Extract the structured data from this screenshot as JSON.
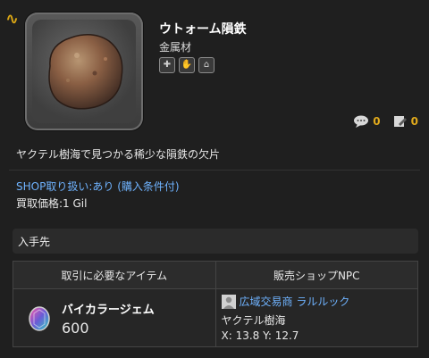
{
  "item": {
    "name": "ウトォーム隕鉄",
    "category": "金属材",
    "description": "ヤクテル樹海で見つかる稀少な隕鉄の欠片",
    "badges": [
      {
        "icon": "plus-icon",
        "glyph": "✚"
      },
      {
        "icon": "hand-icon",
        "glyph": "✋"
      },
      {
        "icon": "market-icon",
        "glyph": "⌂"
      }
    ],
    "counts": {
      "comments": "0",
      "notes": "0"
    }
  },
  "shop": {
    "label": "SHOP取り扱い:",
    "availability": "あり",
    "condition": "(購入条件付)"
  },
  "price": {
    "text": "買取価格:1 Gil"
  },
  "source": {
    "title": "入手先"
  },
  "exchange_table": {
    "headers": [
      "取引に必要なアイテム",
      "販売ショップNPC"
    ],
    "rows": [
      {
        "required_item": "バイカラージェム",
        "quantity": "600",
        "npc_name": "広域交易商 ラルルック",
        "npc_location": "ヤクテル樹海",
        "npc_coords": "X: 13.8 Y: 12.7"
      }
    ]
  },
  "colors": {
    "accent": "#e0a91c",
    "link": "#6fb3ff",
    "background": "#1f1f1f"
  }
}
